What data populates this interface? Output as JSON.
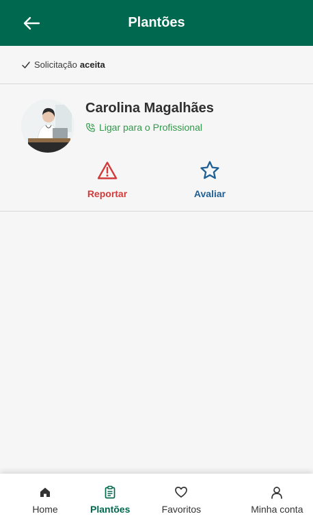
{
  "header": {
    "title": "Plantões",
    "back_icon": "arrow-left-icon",
    "background": "#00684f"
  },
  "status": {
    "prefix": "Solicitação",
    "value": "aceita",
    "icon": "check-icon"
  },
  "professional": {
    "name": "Carolina Magalhães",
    "call_label": "Ligar para o Profissional",
    "avatar_icon": "avatar-photo",
    "call_color": "#2e9a48"
  },
  "actions": {
    "report_label": "Reportar",
    "report_color": "#d23a3a",
    "report_icon": "warning-triangle-icon",
    "rate_label": "Avaliar",
    "rate_color": "#1f5f93",
    "rate_icon": "star-outline-icon"
  },
  "nav": {
    "items": [
      {
        "label": "Home",
        "icon": "home-icon",
        "active": false
      },
      {
        "label": "Plantões",
        "icon": "clipboard-icon",
        "active": true
      },
      {
        "label": "Favoritos",
        "icon": "heart-icon",
        "active": false
      },
      {
        "label": "Minha conta",
        "icon": "user-icon",
        "active": false
      }
    ]
  }
}
